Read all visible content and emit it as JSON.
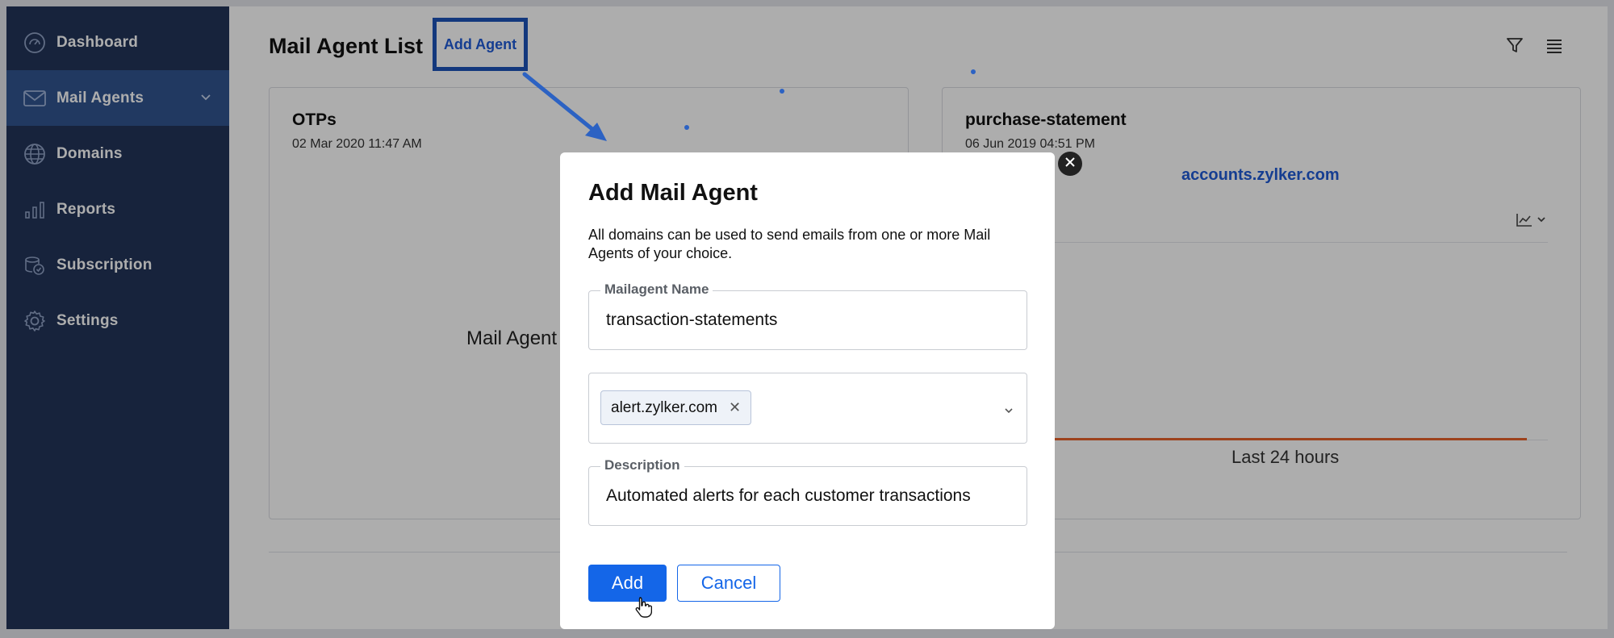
{
  "sidebar": {
    "items": [
      {
        "label": "Dashboard",
        "icon": "dashboard-gauge-icon"
      },
      {
        "label": "Mail Agents",
        "icon": "envelope-icon",
        "active": true
      },
      {
        "label": "Domains",
        "icon": "globe-icon"
      },
      {
        "label": "Reports",
        "icon": "bar-chart-icon"
      },
      {
        "label": "Subscription",
        "icon": "subscription-icon"
      },
      {
        "label": "Settings",
        "icon": "gear-icon"
      }
    ]
  },
  "header": {
    "title": "Mail Agent List",
    "add_agent_label": "Add Agent"
  },
  "cards": [
    {
      "title": "OTPs",
      "date": "02 Mar 2020 11:47 AM",
      "body_text": "Mail Agent"
    },
    {
      "title": "purchase-statement",
      "date": "06 Jun 2019 04:51 PM",
      "domain": "accounts.zylker.com",
      "footer": "Last 24 hours"
    }
  ],
  "modal": {
    "title": "Add Mail Agent",
    "description": "All domains can be used to send emails from one or more Mail Agents of your choice.",
    "name_field": {
      "label": "Mailagent Name",
      "value": "transaction-statements"
    },
    "domains_field": {
      "chips": [
        "alert.zylker.com"
      ]
    },
    "description_field": {
      "label": "Description",
      "value": "Automated alerts for each customer transactions"
    },
    "add_label": "Add",
    "cancel_label": "Cancel"
  },
  "colors": {
    "sidebar_bg": "#223459",
    "sidebar_active": "#31548f",
    "primary": "#1466e8",
    "link": "#1f5bd6",
    "highlight_box": "#1c53b8",
    "chart_line": "#e8622c"
  }
}
